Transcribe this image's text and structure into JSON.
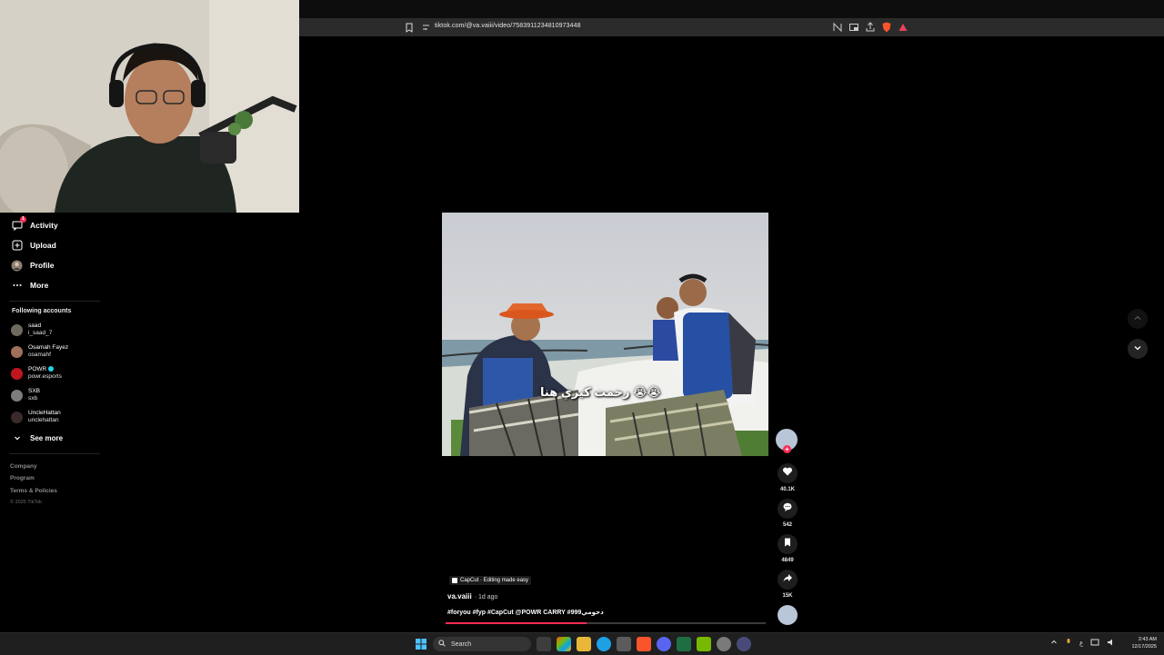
{
  "browser": {
    "url": "tiktok.com/@va.vaiii/video/7583911234810973448"
  },
  "sidebar": {
    "nav": [
      {
        "label": "Activity",
        "icon": "activity-icon",
        "badge": "1"
      },
      {
        "label": "Upload",
        "icon": "upload-icon"
      },
      {
        "label": "Profile",
        "icon": "profile-icon"
      },
      {
        "label": "More",
        "icon": "more-icon"
      }
    ],
    "following_title": "Following accounts",
    "accounts": [
      {
        "name": "saad",
        "handle": "i_saad_7"
      },
      {
        "name": "Osamah Fayez",
        "handle": "osamahf"
      },
      {
        "name": "POWR",
        "handle": "powr.esports",
        "verified": true
      },
      {
        "name": "SXB",
        "handle": "sxb"
      },
      {
        "name": "UncleHattan",
        "handle": "unclehattan"
      }
    ],
    "see_more": "See more",
    "footer": [
      "Company",
      "Program",
      "Terms & Policies"
    ],
    "copyright": "© 2025 TikTok"
  },
  "video": {
    "caption_overlay": "رحمت كيري هنا 😭😭",
    "capcut_label": "CapCut · Editing made easy",
    "author": "va.vaiii",
    "posted": "· 1d ago",
    "hashtags": "#foryou #fyp #CapCut @POWR CARRY #999دحومي",
    "progress": 0.44
  },
  "actions": {
    "likes": "40.1K",
    "comments": "542",
    "saves": "4849",
    "shares": "15K"
  },
  "taskbar": {
    "search_placeholder": "Search",
    "lang": "ع",
    "time": "2:43 AM",
    "date": "12/17/2025"
  },
  "colors": {
    "accent": "#fe2c55",
    "background": "#000000",
    "verified": "#20d5ec"
  }
}
